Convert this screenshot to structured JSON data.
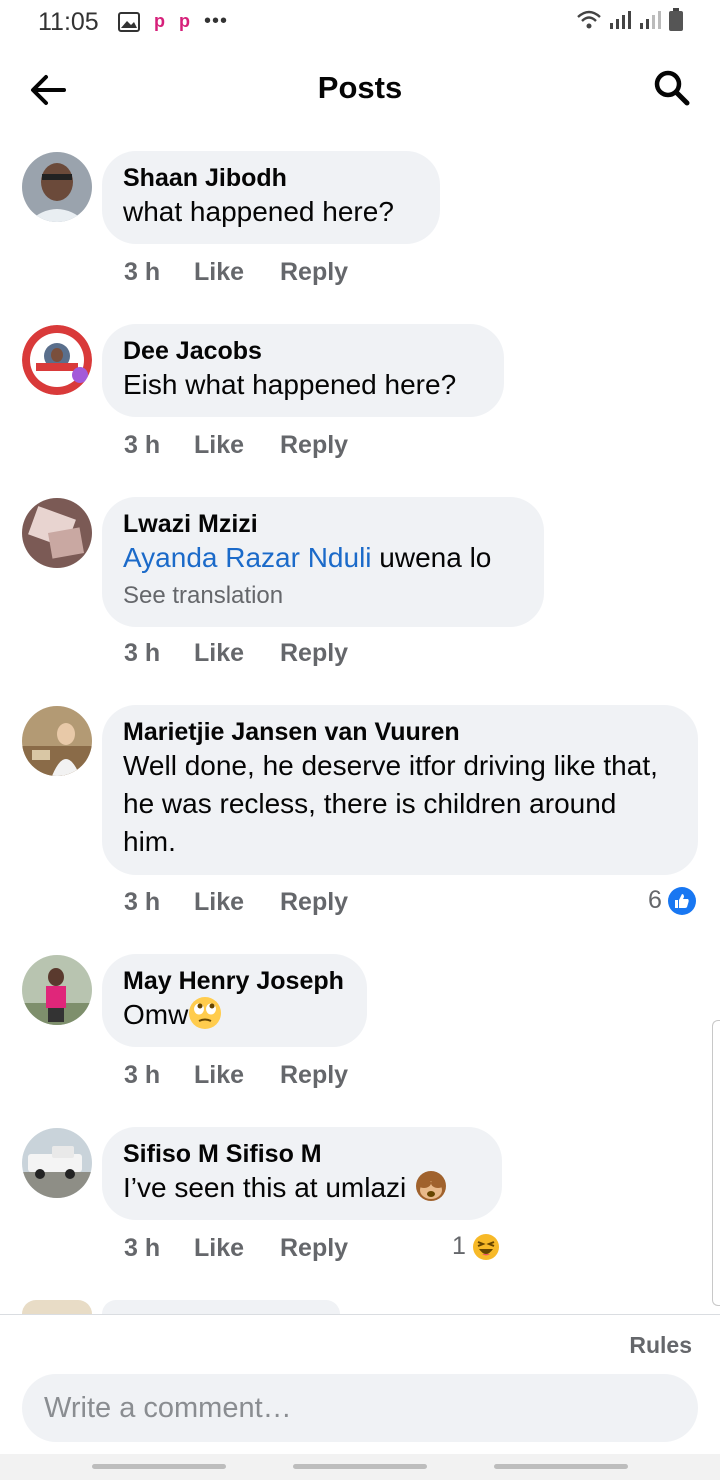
{
  "status": {
    "time": "11:05"
  },
  "header": {
    "title": "Posts"
  },
  "comments": [
    {
      "author": "Shaan Jibodh",
      "text": "what happened here?",
      "time": "3 h",
      "like": "Like",
      "reply": "Reply"
    },
    {
      "author": "Dee Jacobs",
      "text": "Eish what happened here?",
      "time": "3 h",
      "like": "Like",
      "reply": "Reply"
    },
    {
      "author": "Lwazi Mzizi",
      "mention": "Ayanda Razar Nduli",
      "text": " uwena lo",
      "see_translation": "See translation",
      "time": "3 h",
      "like": "Like",
      "reply": "Reply"
    },
    {
      "author": "Marietjie Jansen van Vuuren",
      "text": "Well done, he deserve itfor driving like that, he was recless, there is children around him.",
      "time": "3 h",
      "like": "Like",
      "reply": "Reply",
      "reaction_count": "6",
      "reaction_icon": "like-thumb-icon"
    },
    {
      "author": "May Henry Joseph",
      "text": "Omw",
      "emoji_icon": "eye-roll-emoji-icon",
      "time": "3 h",
      "like": "Like",
      "reply": "Reply"
    },
    {
      "author": "Sifiso M Sifiso M",
      "text": "I’ve seen this at umlazi ",
      "emoji_icon": "see-no-evil-emoji-icon",
      "time": "3 h",
      "like": "Like",
      "reply": "Reply",
      "reaction_count": "1",
      "reaction_icon": "haha-emoji-icon"
    }
  ],
  "footer": {
    "rules": "Rules",
    "comment_placeholder": "Write a comment…"
  },
  "colors": {
    "mention": "#1b6ac9",
    "bubble": "#f0f2f5",
    "like_blue": "#1877f2"
  }
}
